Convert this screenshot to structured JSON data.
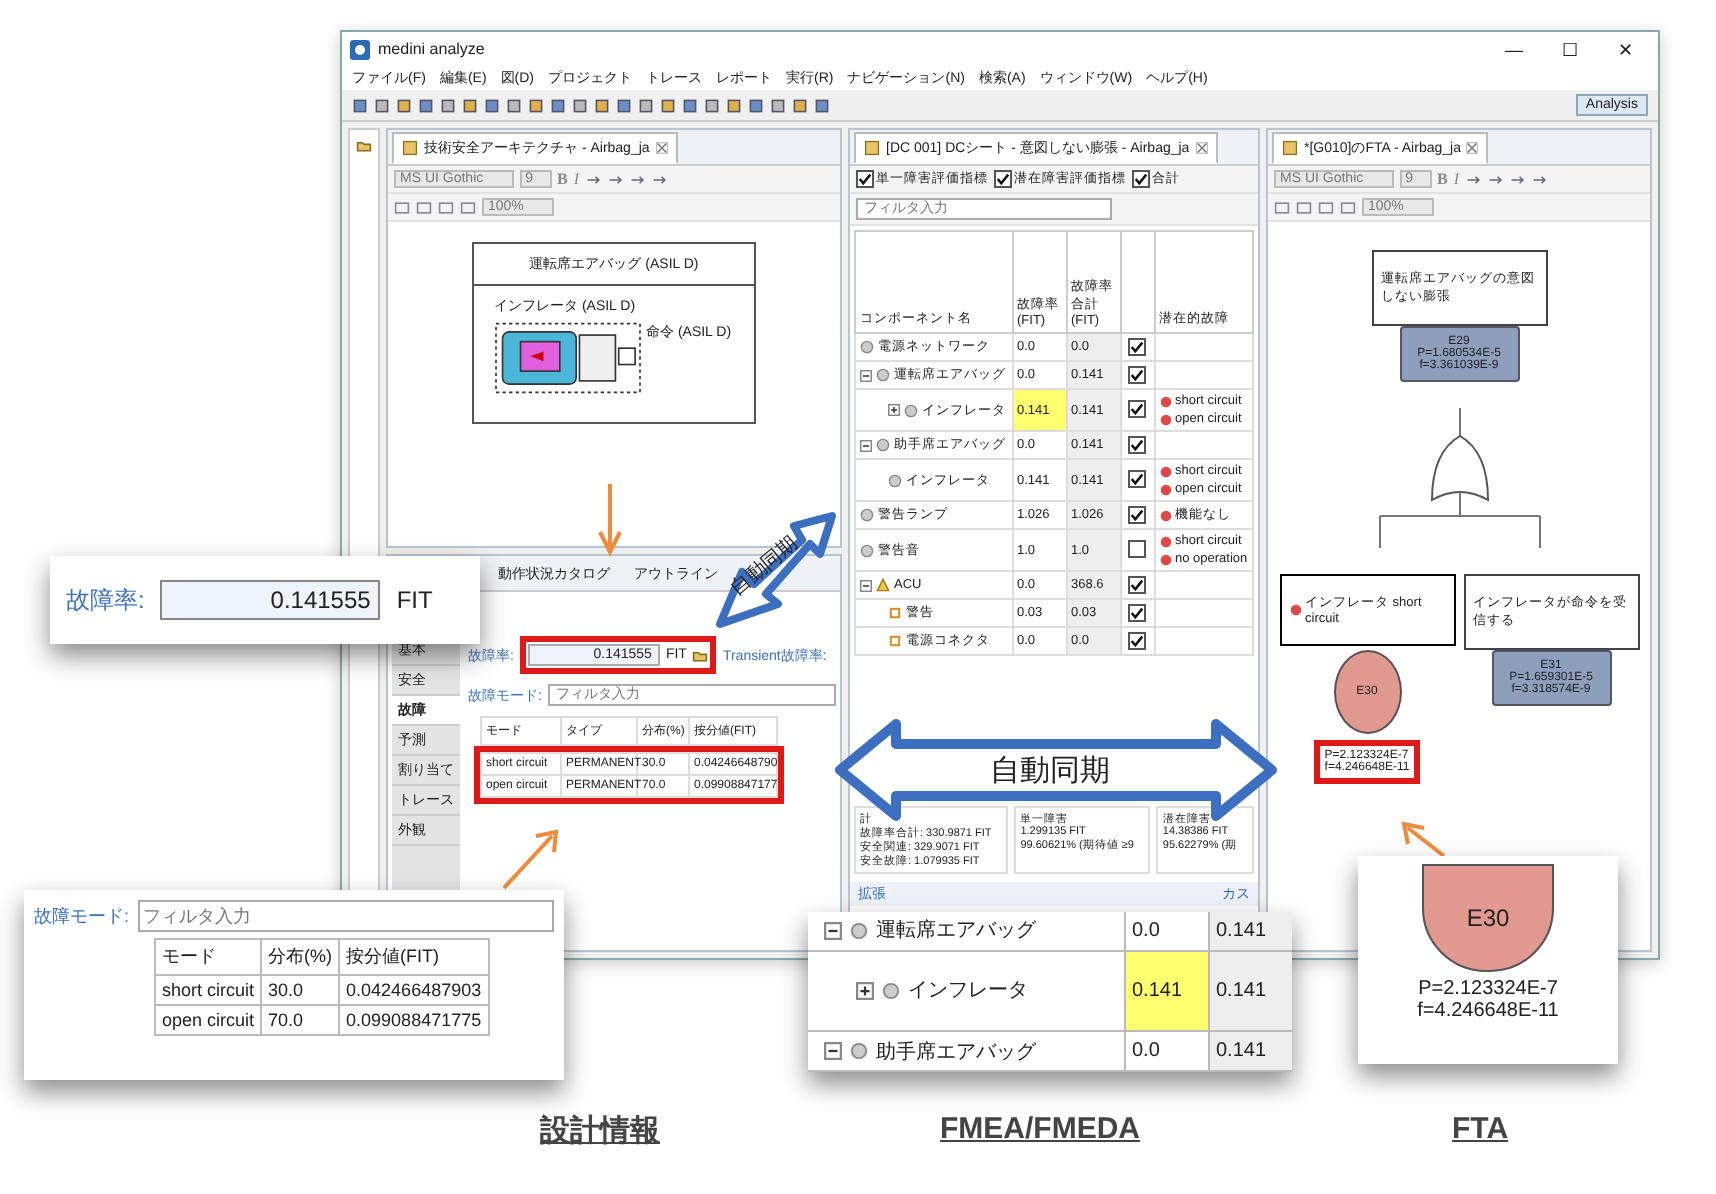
{
  "window": {
    "title": "medini analyze",
    "controls": [
      "—",
      "☐",
      "✕"
    ]
  },
  "menu": [
    "ファイル(F)",
    "編集(E)",
    "図(D)",
    "プロジェクト",
    "トレース",
    "レポート",
    "実行(R)",
    "ナビゲーション(N)",
    "検索(A)",
    "ウィンドウ(W)",
    "ヘルプ(H)"
  ],
  "perspective": "Analysis",
  "architecture_editor": {
    "tab": "技術安全アーキテクチャ - Airbag_ja",
    "font": "MS UI Gothic",
    "font_size": "9",
    "zoom": "100%",
    "format_buttons": [
      "B",
      "I"
    ],
    "diagram": {
      "block": "運転席エアバッグ (ASIL D)",
      "part": "インフレータ (ASIL D)",
      "port": "命令 (ASIL D)"
    }
  },
  "properties": {
    "tabs": [
      {
        "label": "動作状況カタログ",
        "selected": false
      },
      {
        "label": "アウトライン",
        "selected": false
      }
    ],
    "categories": [
      {
        "label": "基本",
        "selected": false
      },
      {
        "label": "安全",
        "selected": false
      },
      {
        "label": "故障",
        "selected": true
      },
      {
        "label": "予測",
        "selected": false
      },
      {
        "label": "割り当て",
        "selected": false
      },
      {
        "label": "トレース",
        "selected": false
      },
      {
        "label": "外観",
        "selected": false
      }
    ],
    "failure_rate_label": "故障率:",
    "failure_rate": "0.141555",
    "unit": "FIT",
    "transient_label": "Transient故障率:",
    "modes_label": "故障モード:",
    "filter_placeholder": "フィルタ入力",
    "columns": [
      "モード",
      "タイプ",
      "分布(%)",
      "按分値(FIT)"
    ],
    "rows": [
      [
        "short circuit",
        "PERMANENT",
        "30.0",
        "0.04246648790"
      ],
      [
        "open circuit",
        "PERMANENT",
        "70.0",
        "0.09908847177"
      ]
    ]
  },
  "dc_sheet": {
    "tab": "[DC 001] DCシート - 意図しない膨張 - Airbag_ja",
    "options": [
      {
        "label": "単一障害評価指標",
        "checked": true
      },
      {
        "label": "潜在障害評価指標",
        "checked": true
      },
      {
        "label": "合計",
        "checked": true
      }
    ],
    "filter_placeholder": "フィルタ入力",
    "columns": [
      "コンポーネント名",
      "故障率(FIT)",
      "故障率合計 (FIT)",
      "潜在的故障"
    ],
    "rows": [
      {
        "kind": "component",
        "name": "電源ネットワーク",
        "rate": "0.0",
        "total": "0.0",
        "checked": true,
        "highlighted": false
      },
      {
        "kind": "component",
        "name": "運転席エアバッグ",
        "rate": "0.0",
        "total": "0.141",
        "checked": true,
        "highlighted": false,
        "expanded": true,
        "children": [
          {
            "kind": "component",
            "name": "インフレータ",
            "rate": "0.141",
            "total": "0.141",
            "checked": true,
            "highlighted": true,
            "expanded": false,
            "faults": [
              "short circuit",
              "open circuit"
            ]
          }
        ]
      },
      {
        "kind": "component",
        "name": "助手席エアバッグ",
        "rate": "0.0",
        "total": "0.141",
        "checked": true,
        "highlighted": false,
        "expanded": true,
        "children": [
          {
            "kind": "component",
            "name": "インフレータ",
            "rate": "0.141",
            "total": "0.141",
            "checked": true,
            "highlighted": false,
            "faults": [
              "short circuit",
              "open circuit"
            ]
          }
        ]
      },
      {
        "kind": "component",
        "name": "警告ランプ",
        "rate": "1.026",
        "total": "1.026",
        "checked": true,
        "highlighted": false,
        "faults": [
          "機能なし"
        ]
      },
      {
        "kind": "component",
        "name": "警告音",
        "rate": "1.0",
        "total": "1.0",
        "checked": false,
        "highlighted": false,
        "faults": [
          "short circuit",
          "no operation"
        ]
      },
      {
        "kind": "unit",
        "name": "ACU",
        "rate": "0.0",
        "total": "368.6",
        "checked": true,
        "highlighted": false,
        "expanded": true,
        "children": [
          {
            "kind": "port",
            "name": "警告",
            "rate": "0.03",
            "total": "0.03",
            "checked": true,
            "highlighted": false
          },
          {
            "kind": "port",
            "name": "電源コネクタ",
            "rate": "0.0",
            "total": "0.0",
            "checked": true,
            "highlighted": false
          }
        ]
      }
    ],
    "summary": {
      "title": "計",
      "totals": [
        {
          "label": "故障率合計:",
          "value": "330.9871 FIT"
        },
        {
          "label": "安全関連:",
          "value": "329.9071 FIT"
        },
        {
          "label": "安全故障:",
          "value": "1.079935 FIT"
        }
      ],
      "single": {
        "title": "単一障害",
        "value": "1.299135 FIT",
        "ratio": "99.60621% (期待値 ≥9"
      },
      "latent": {
        "title": "潜在障害",
        "value": "14.38386 FIT",
        "ratio": "95.62279% (期"
      }
    },
    "expand_link": "拡張",
    "customize_link": "カス"
  },
  "fta": {
    "tab": "*[G010]のFTA - Airbag_ja",
    "font": "MS UI Gothic",
    "font_size": "9",
    "zoom": "100%",
    "format_buttons": [
      "B",
      "I"
    ],
    "top_event": "運転席エアバッグの意図しない膨張",
    "top_gate": {
      "name": "E29",
      "p": "P=1.680534E-5",
      "f": "f=3.361039E-9"
    },
    "left_event": "インフレータ short circuit",
    "left_basic": {
      "name": "E30",
      "p": "P=2.123324E-7",
      "f": "f=4.246648E-11"
    },
    "right_event": "インフレータが命令を受信する",
    "right_gate": {
      "name": "E31",
      "p": "P=1.659301E-5",
      "f": "f=3.318574E-9"
    }
  },
  "callouts": {
    "failure_rate": {
      "label": "故障率:",
      "value": "0.141555",
      "unit": "FIT"
    },
    "failure_modes": {
      "label": "故障モード:",
      "placeholder": "フィルタ入力",
      "columns": [
        "モード",
        "分布(%)",
        "按分値(FIT)"
      ],
      "rows": [
        [
          "short circuit",
          "30.0",
          "0.042466487903"
        ],
        [
          "open circuit",
          "70.0",
          "0.099088471775"
        ]
      ]
    },
    "fmea": [
      {
        "name": "運転席エアバッグ",
        "rate": "0.0",
        "total": "0.141",
        "highlighted": false,
        "kind": "parent"
      },
      {
        "name": "インフレータ",
        "rate": "0.141",
        "total": "0.141",
        "highlighted": true,
        "kind": "child"
      },
      {
        "name": "助手席エアバッグ",
        "rate": "0.0",
        "total": "0.141",
        "highlighted": false,
        "kind": "parent"
      }
    ],
    "fta": {
      "name": "E30",
      "p": "P=2.123324E-7",
      "f": "f=4.246648E-11"
    }
  },
  "sync_labels": [
    "自動同期",
    "自動同期"
  ],
  "captions": [
    "設計情報",
    "FMEA/FMEDA",
    "FTA"
  ]
}
